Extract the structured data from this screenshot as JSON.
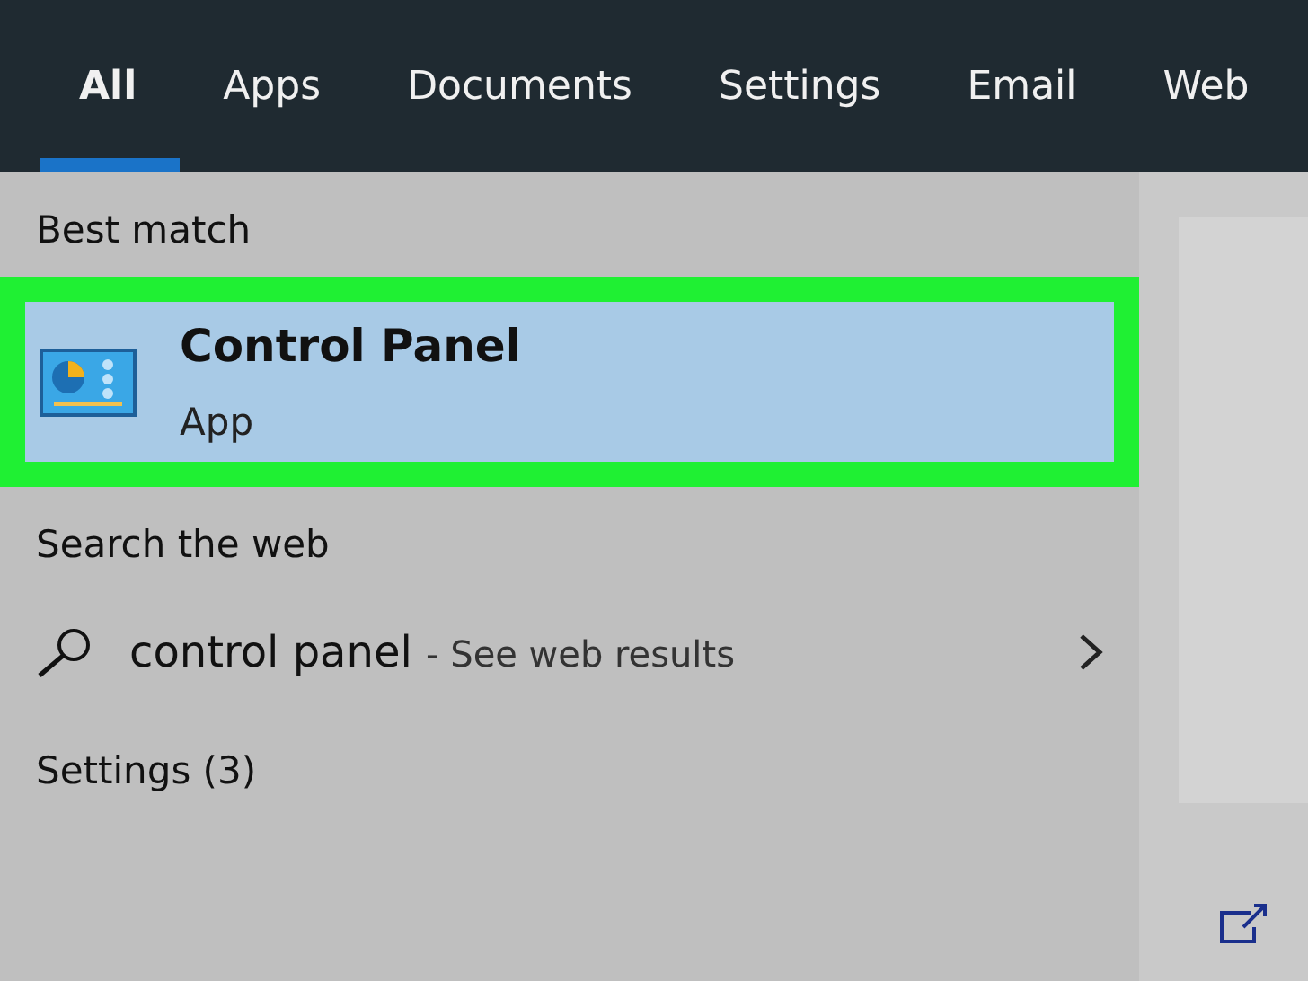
{
  "tabs": [
    {
      "label": "All",
      "selected": true
    },
    {
      "label": "Apps",
      "selected": false
    },
    {
      "label": "Documents",
      "selected": false
    },
    {
      "label": "Settings",
      "selected": false
    },
    {
      "label": "Email",
      "selected": false
    },
    {
      "label": "Web",
      "selected": false
    }
  ],
  "best_match": {
    "heading": "Best match",
    "result": {
      "title": "Control Panel",
      "subtitle": "App",
      "selected": true,
      "highlighted": true
    }
  },
  "web_search": {
    "heading": "Search the web",
    "query": "control panel",
    "suffix": "- See web results"
  },
  "settings": {
    "heading": "Settings (3)"
  }
}
